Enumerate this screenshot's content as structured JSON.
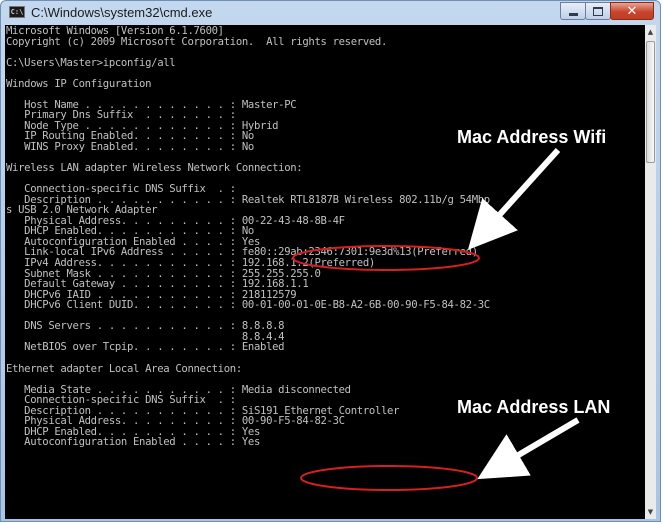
{
  "window": {
    "title": "C:\\Windows\\system32\\cmd.exe",
    "icon_label": "C:\\"
  },
  "console": {
    "lines": [
      "Microsoft Windows [Version 6.1.7600]",
      "Copyright (c) 2009 Microsoft Corporation.  All rights reserved.",
      "",
      "C:\\Users\\Master>ipconfig/all",
      "",
      "Windows IP Configuration",
      "",
      "   Host Name . . . . . . . . . . . . : Master-PC",
      "   Primary Dns Suffix  . . . . . . . :",
      "   Node Type . . . . . . . . . . . . : Hybrid",
      "   IP Routing Enabled. . . . . . . . : No",
      "   WINS Proxy Enabled. . . . . . . . : No",
      "",
      "Wireless LAN adapter Wireless Network Connection:",
      "",
      "   Connection-specific DNS Suffix  . :",
      "   Description . . . . . . . . . . . : Realtek RTL8187B Wireless 802.11b/g 54Mbp",
      "s USB 2.0 Network Adapter",
      "   Physical Address. . . . . . . . . : 00-22-43-48-8B-4F",
      "   DHCP Enabled. . . . . . . . . . . : No",
      "   Autoconfiguration Enabled . . . . : Yes",
      "   Link-local IPv6 Address . . . . . : fe80::29ab:2346:7301:9e3d%13(Preferred)",
      "   IPv4 Address. . . . . . . . . . . : 192.168.1.2(Preferred)",
      "   Subnet Mask . . . . . . . . . . . : 255.255.255.0",
      "   Default Gateway . . . . . . . . . : 192.168.1.1",
      "   DHCPv6 IAID . . . . . . . . . . . : 218112579",
      "   DHCPv6 Client DUID. . . . . . . . : 00-01-00-01-0E-B8-A2-6B-00-90-F5-84-82-3C",
      "",
      "   DNS Servers . . . . . . . . . . . : 8.8.8.8",
      "                                       8.8.4.4",
      "   NetBIOS over Tcpip. . . . . . . . : Enabled",
      "",
      "Ethernet adapter Local Area Connection:",
      "",
      "   Media State . . . . . . . . . . . : Media disconnected",
      "   Connection-specific DNS Suffix  . :",
      "   Description . . . . . . . . . . . : SiS191 Ethernet Controller",
      "   Physical Address. . . . . . . . . : 00-90-F5-84-82-3C",
      "   DHCP Enabled. . . . . . . . . . . : Yes",
      "   Autoconfiguration Enabled . . . . : Yes"
    ]
  },
  "annotations": {
    "wifi_label": "Mac Address Wifi",
    "lan_label": "Mac Address LAN",
    "highlight_color": "#d42020",
    "arrow_color": "#ffffff"
  }
}
